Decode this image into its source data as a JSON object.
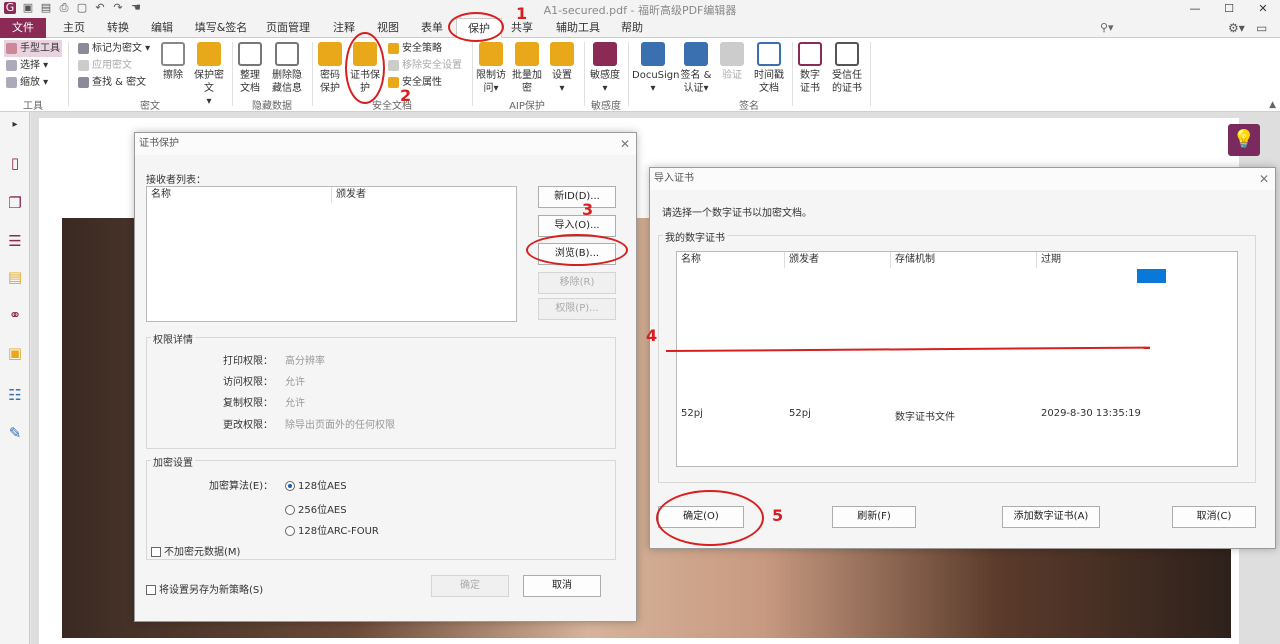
{
  "window": {
    "title": "A1-secured.pdf - 福昕高级PDF编辑器"
  },
  "tabs": [
    "文件",
    "主页",
    "转换",
    "编辑",
    "填写&签名",
    "页面管理",
    "注释",
    "视图",
    "表单",
    "保护",
    "共享",
    "辅助工具",
    "帮助"
  ],
  "search": {
    "placeholder": "查找"
  },
  "ribbon": {
    "tools": {
      "hand": "手型工具",
      "select": "选择",
      "zoom": "缩放",
      "label": "工具"
    },
    "redact": {
      "mark": "标记为密文",
      "apply": "应用密文",
      "find": "查找 & 密文",
      "erase": "擦除",
      "protect": "保护密文",
      "label": "密文"
    },
    "hidden": {
      "sanitize": "整理文档",
      "remove": "删除隐藏信息",
      "label": "隐藏数据"
    },
    "secure": {
      "password": "密码保护",
      "cert": "证书保护",
      "policy": "安全策略",
      "remove": "移除安全设置",
      "props": "安全属性",
      "label": "安全文档"
    },
    "aip": {
      "restrict": "限制访问",
      "batch": "批量加密",
      "settings": "设置",
      "label": "AIP保护"
    },
    "sens": {
      "sensitivity": "敏感度",
      "label": "敏感度"
    },
    "sign": {
      "docusign": "DocuSign",
      "sign": "签名 & 认证",
      "validate": "验证",
      "timestamp": "时间戳文档",
      "digital": "数字证书",
      "trusted": "受信任的证书",
      "label": "签名"
    }
  },
  "cert_dialog": {
    "title": "证书保护",
    "recipients_label": "接收者列表：",
    "col_name": "名称",
    "col_issuer": "颁发者",
    "btn_new_id": "新ID(D)...",
    "btn_import": "导入(O)...",
    "btn_browse": "浏览(B)...",
    "btn_remove": "移除(R)",
    "btn_perms": "权限(P)...",
    "perm_group": "权限详情",
    "perms": [
      {
        "k": "打印权限：",
        "v": "高分辨率"
      },
      {
        "k": "访问权限：",
        "v": "允许"
      },
      {
        "k": "复制权限：",
        "v": "允许"
      },
      {
        "k": "更改权限：",
        "v": "除导出页面外的任何权限"
      }
    ],
    "enc_group": "加密设置",
    "enc_algo_label": "加密算法(E)：",
    "enc_options": [
      "128位AES",
      "256位AES",
      "128位ARC-FOUR"
    ],
    "no_meta": "不加密元数据(M)",
    "save_policy": "将设置另存为新策略(S)",
    "btn_ok": "确定",
    "btn_cancel": "取消"
  },
  "import_dialog": {
    "title": "导入证书",
    "prompt": "请选择一个数字证书以加密文档。",
    "group": "我的数字证书",
    "cols": [
      "名称",
      "颁发者",
      "存储机制",
      "过期"
    ],
    "rows": [
      {
        "name": "52pj",
        "issuer": "52pj",
        "store": "数字证书文件",
        "expiry": "2029-8-30 13:35:19"
      }
    ],
    "btn_ok": "确定(O)",
    "btn_refresh": "刷新(F)",
    "btn_add": "添加数字证书(A)",
    "btn_cancel": "取消(C)"
  },
  "annotations": [
    "1",
    "2",
    "3",
    "4",
    "5"
  ],
  "colors": {
    "brand": "#8a2a55",
    "annotation": "#d81e1e",
    "selection": "#0a78d7"
  }
}
